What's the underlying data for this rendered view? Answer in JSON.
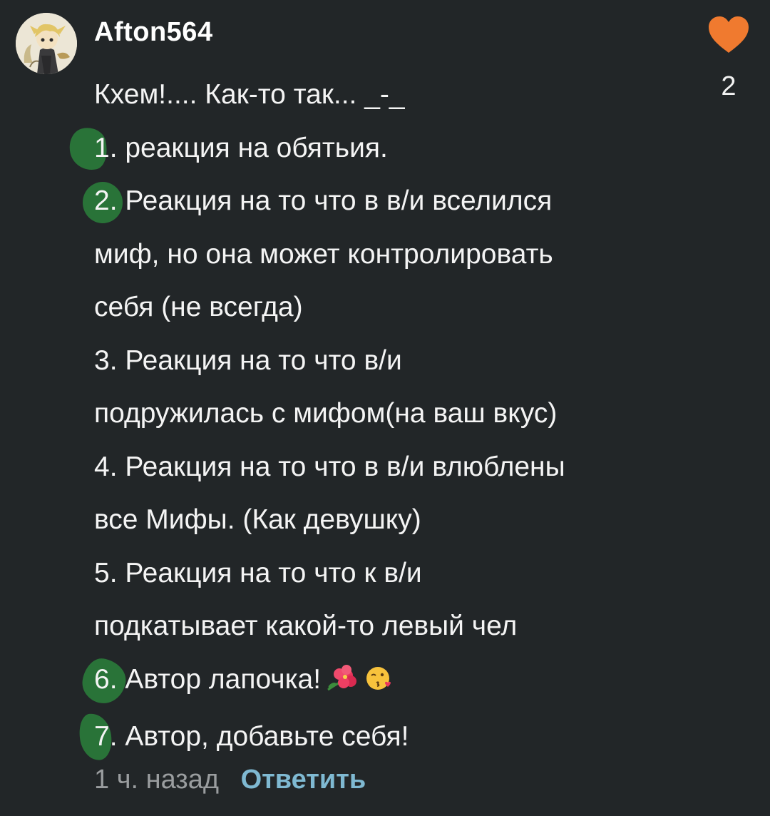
{
  "comment": {
    "username": "Afton564",
    "avatar_icon": "user-avatar",
    "like_icon": "heart-icon",
    "like_color": "#f07a2f",
    "like_count": "2",
    "lines": [
      "Кхем!.... Как-то так... _-_",
      "1. реакция на обятьия.",
      "2. Реакция на то что в в/и вселился",
      "миф, но она может контролировать",
      "себя (не всегда)",
      "3. Реакция на то что в/и",
      "подружилась с мифом(на ваш вкус)",
      "4. Реакция на то что в в/и влюблены",
      "все Мифы. (Как девушку)",
      "5. Реакция на то что к в/и",
      "подкатывает какой-то левый чел",
      "6. Автор лапочка!",
      "7. Автор, добавьте себя!"
    ],
    "emojis": [
      "hibiscus-emoji",
      "kissing-face-emoji"
    ],
    "time": "1 ч. назад",
    "reply_label": "Ответить",
    "reply_color": "#7fb9d2",
    "marker_color": "#2a7a3a"
  }
}
